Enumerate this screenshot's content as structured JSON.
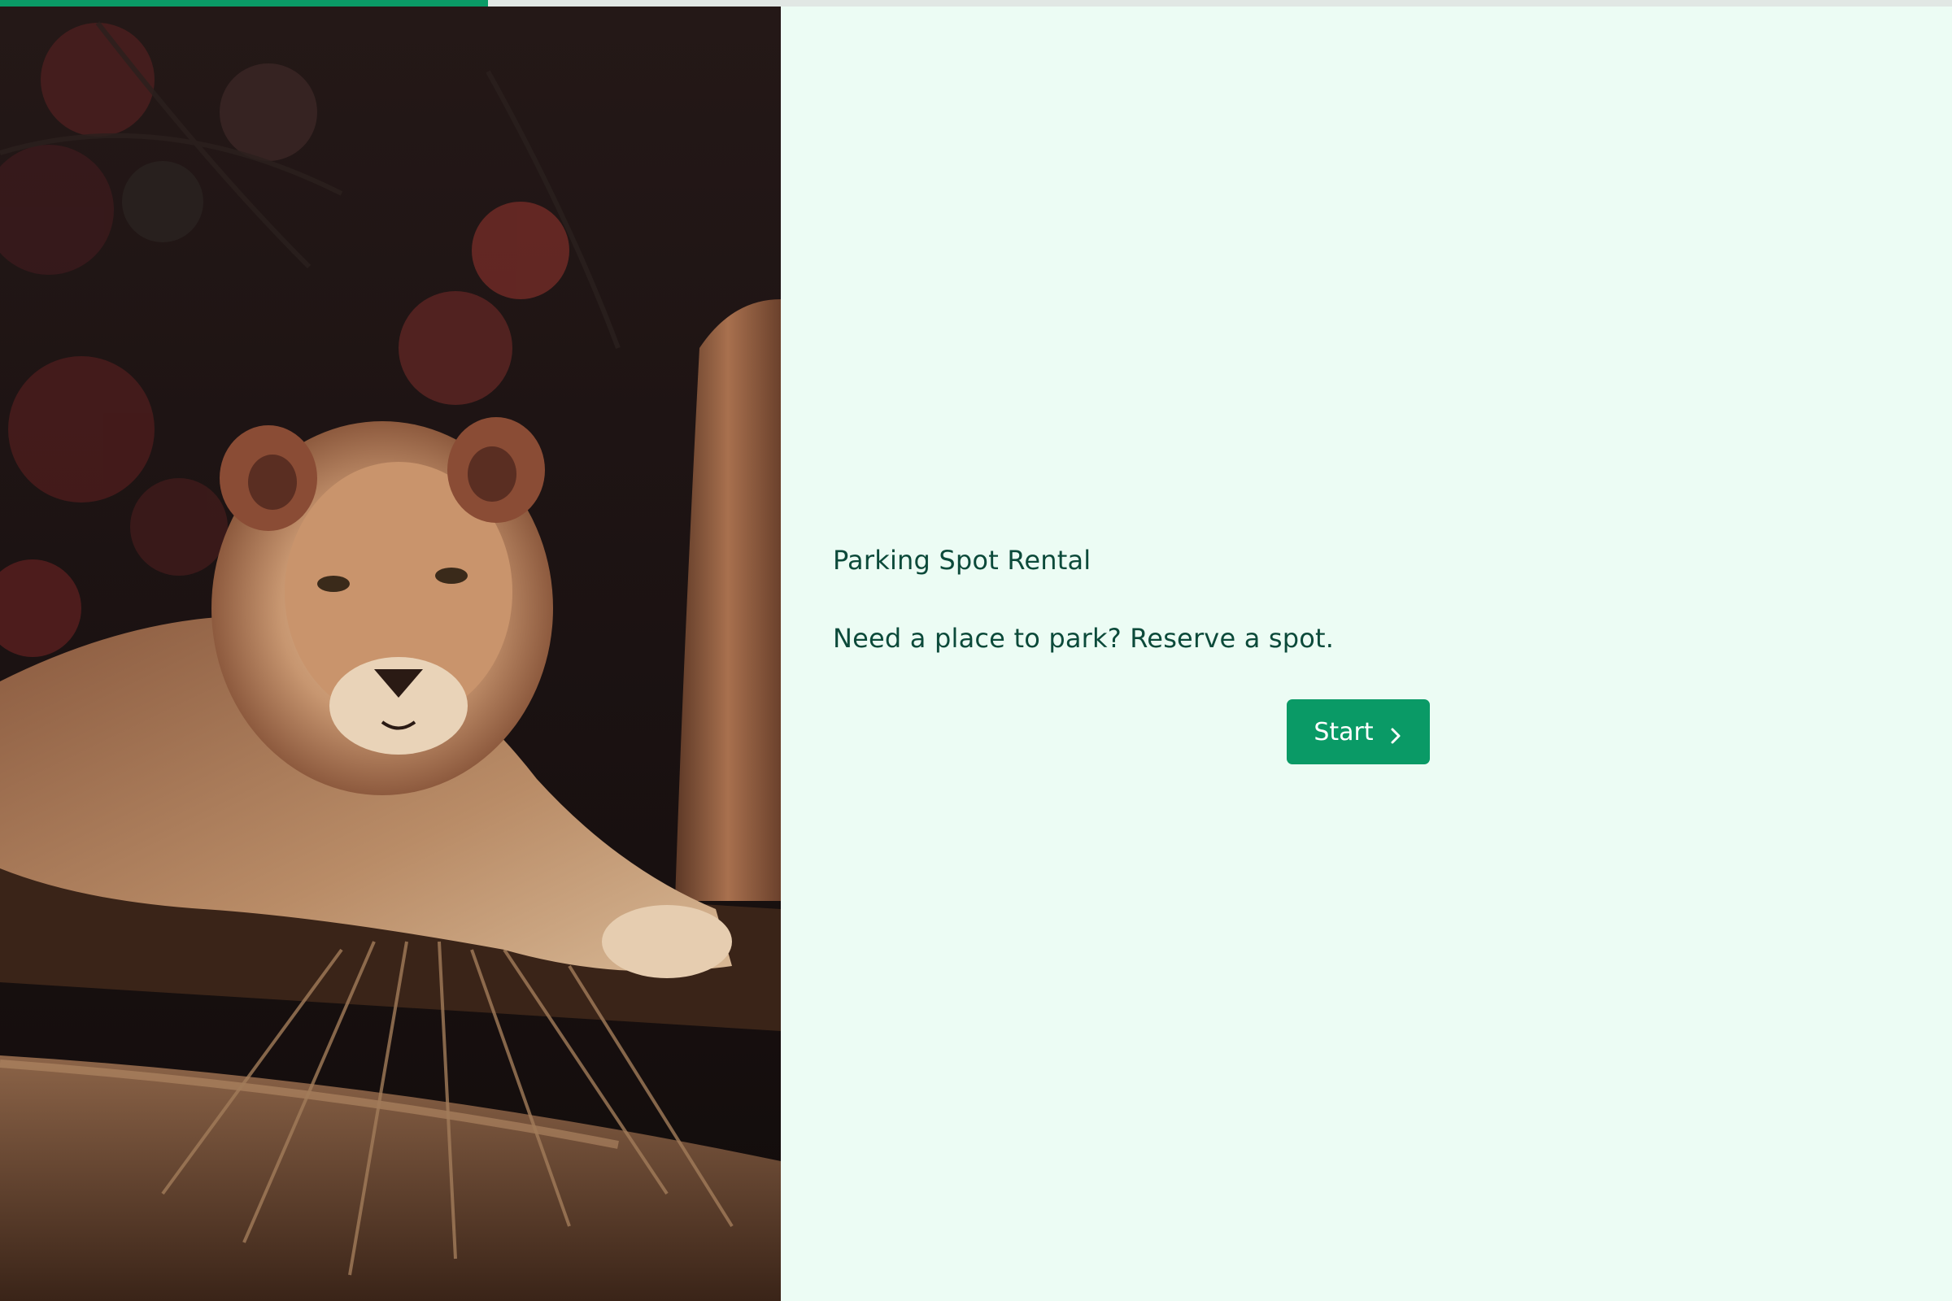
{
  "progress": {
    "fraction": 0.25,
    "fill_color": "#0a9a66",
    "track_color": "#e1e7e4"
  },
  "hero": {
    "image": "lioness-resting-on-logs-photo"
  },
  "form": {
    "title": "Parking Spot Rental",
    "subtitle": "Need a place to park? Reserve a spot.",
    "start_label": "Start",
    "start_icon": "chevron-right-icon"
  },
  "colors": {
    "background": "#ecfcf4",
    "accent": "#0a9a66",
    "text": "#0c4a3a"
  }
}
